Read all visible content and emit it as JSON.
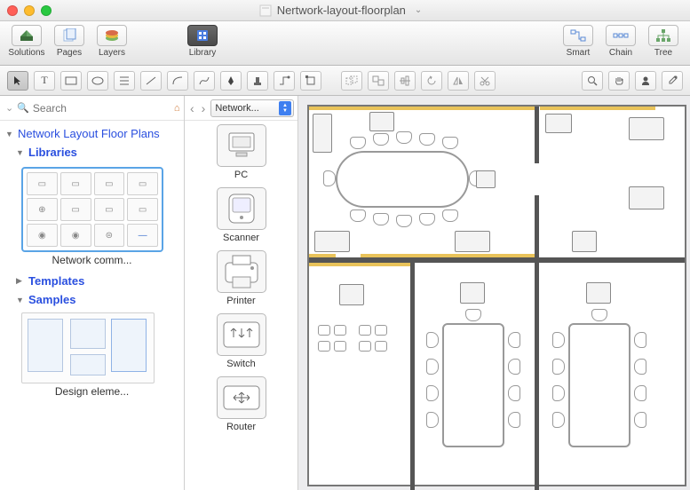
{
  "title": "Nertwork-layout-floorplan",
  "toolbar": {
    "solutions": "Solutions",
    "pages": "Pages",
    "layers": "Layers",
    "library": "Library",
    "smart": "Smart",
    "chain": "Chain",
    "tree": "Tree"
  },
  "search": {
    "placeholder": "Search"
  },
  "tree": {
    "root": "Network Layout Floor Plans",
    "libraries": "Libraries",
    "thumb_label": "Network comm...",
    "templates": "Templates",
    "samples": "Samples",
    "sample_label": "Design eleme..."
  },
  "librarySelector": "Network...",
  "libItems": {
    "pc": "PC",
    "scanner": "Scanner",
    "printer": "Printer",
    "switch": "Switch",
    "router": "Router"
  }
}
